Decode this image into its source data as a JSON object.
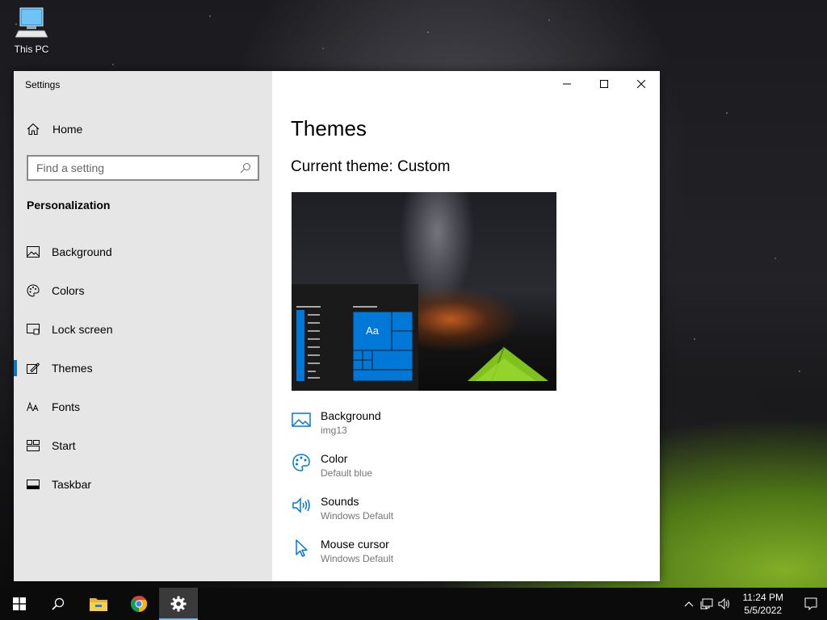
{
  "desktop": {
    "icons": [
      {
        "label": "This PC",
        "icon": "computer-icon"
      }
    ]
  },
  "window": {
    "title": "Settings",
    "controls": [
      "minimize-icon",
      "maximize-icon",
      "close-icon"
    ]
  },
  "sidebar": {
    "home_label": "Home",
    "search_placeholder": "Find a setting",
    "section_title": "Personalization",
    "items": [
      {
        "label": "Background",
        "icon": "image-icon"
      },
      {
        "label": "Colors",
        "icon": "palette-icon"
      },
      {
        "label": "Lock screen",
        "icon": "lock-screen-icon"
      },
      {
        "label": "Themes",
        "icon": "themes-icon",
        "active": true
      },
      {
        "label": "Fonts",
        "icon": "fonts-icon"
      },
      {
        "label": "Start",
        "icon": "start-icon"
      },
      {
        "label": "Taskbar",
        "icon": "taskbar-icon"
      }
    ]
  },
  "main": {
    "heading": "Themes",
    "current_theme": "Current theme: Custom",
    "preview_tile_label": "Aa",
    "properties": [
      {
        "title": "Background",
        "value": "img13",
        "icon": "image-icon"
      },
      {
        "title": "Color",
        "value": "Default blue",
        "icon": "palette-icon"
      },
      {
        "title": "Sounds",
        "value": "Windows Default",
        "icon": "speaker-icon"
      },
      {
        "title": "Mouse cursor",
        "value": "Windows Default",
        "icon": "cursor-icon"
      }
    ]
  },
  "taskbar": {
    "items": [
      "windows-start-icon",
      "search-icon",
      "file-explorer-icon",
      "chrome-icon",
      "settings-icon"
    ],
    "active": "settings-icon",
    "time": "11:24 PM",
    "date": "5/5/2022"
  },
  "colors": {
    "accent": "#0078d7",
    "sidebar_bg": "#e6e6e6",
    "taskbar_bg": "#0b0b0b"
  }
}
